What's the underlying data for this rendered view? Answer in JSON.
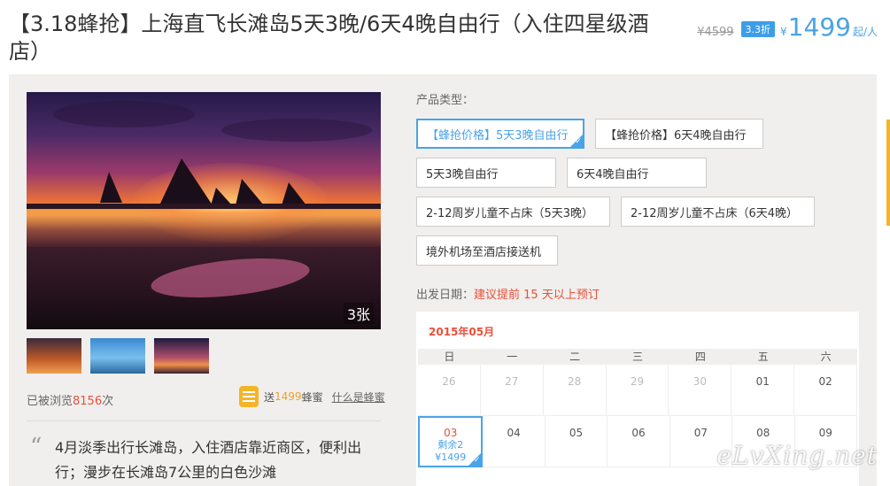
{
  "header": {
    "title": "【3.18蜂抢】上海直飞长滩岛5天3晚/6天4晚自由行（入住四星级酒店）",
    "old_price": "¥4599",
    "discount": "3.3折",
    "yen": "¥",
    "price": "1499",
    "per": "起/人"
  },
  "gallery": {
    "count": "3张",
    "thumbs": [
      "thumb-1",
      "thumb-2",
      "thumb-3"
    ]
  },
  "stats": {
    "views_prefix": "已被浏览",
    "views": "8156",
    "views_suffix": "次",
    "bee_prefix": "送",
    "bee_honey": "1499",
    "bee_suffix": "蜂蜜",
    "bee_what": "什么是蜂蜜"
  },
  "description": {
    "quote": "“",
    "text": "4月淡季出行长滩岛，入住酒店靠近商区，便利出行；漫步在长滩岛7公里的白色沙滩"
  },
  "product": {
    "label": "产品类型：",
    "options": [
      {
        "label": "【蜂抢价格】5天3晚自由行",
        "selected": true
      },
      {
        "label": "【蜂抢价格】6天4晚自由行",
        "selected": false
      },
      {
        "label": "5天3晚自由行",
        "selected": false
      },
      {
        "label": "6天4晚自由行",
        "selected": false
      },
      {
        "label": "2-12周岁儿童不占床（5天3晚）",
        "selected": false
      },
      {
        "label": "2-12周岁儿童不占床（6天4晚）",
        "selected": false
      },
      {
        "label": "境外机场至酒店接送机",
        "selected": false
      }
    ]
  },
  "date": {
    "label": "出发日期：",
    "hint": "建议提前 15 天以上预订"
  },
  "calendar": {
    "month": "2015年05月",
    "weekdays": [
      "日",
      "一",
      "二",
      "三",
      "四",
      "五",
      "六"
    ],
    "row1": [
      "26",
      "27",
      "28",
      "29",
      "30",
      "01",
      "02"
    ],
    "row2": [
      "03",
      "04",
      "05",
      "06",
      "07",
      "08",
      "09"
    ],
    "selected_day": {
      "day": "03",
      "remain": "剩余2",
      "price": "¥1499"
    }
  },
  "watermark": "eLvXing.net",
  "colors": {
    "accent": "#4aa3e6",
    "warn": "#e8503a",
    "bee": "#f4b42a"
  }
}
